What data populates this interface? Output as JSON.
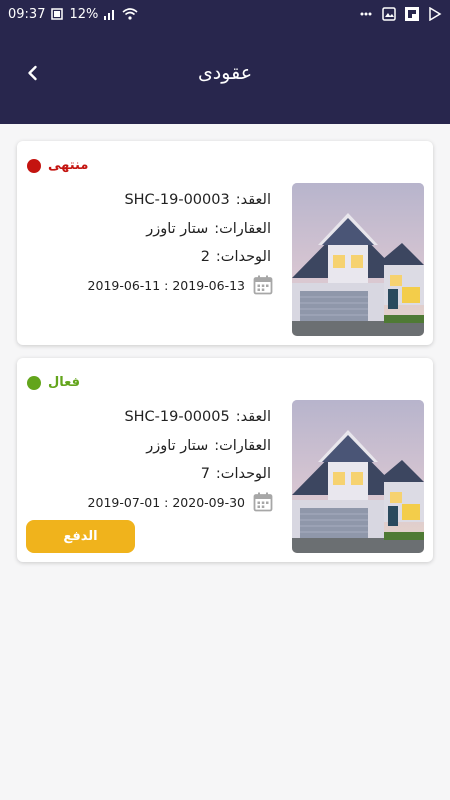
{
  "statusbar": {
    "time": "09:37",
    "battery": "12%"
  },
  "header": {
    "title": "عقودى"
  },
  "contracts": [
    {
      "status": "منتهى",
      "status_color": "#c41410",
      "contract_label": "العقد:",
      "contract_no": "SHC-19-00003",
      "property_label": "العقارات:",
      "property_name": "ستار تاوزر",
      "units_label": "الوحدات:",
      "units": "2",
      "dates": "2019-06-11 : 2019-06-13"
    },
    {
      "status": "فعال",
      "status_color": "#63a51c",
      "contract_label": "العقد:",
      "contract_no": "SHC-19-00005",
      "property_label": "العقارات:",
      "property_name": "ستار تاوزر",
      "units_label": "الوحدات:",
      "units": "7",
      "dates": "2019-07-01 : 2020-09-30",
      "pay_label": "الدفع"
    }
  ]
}
